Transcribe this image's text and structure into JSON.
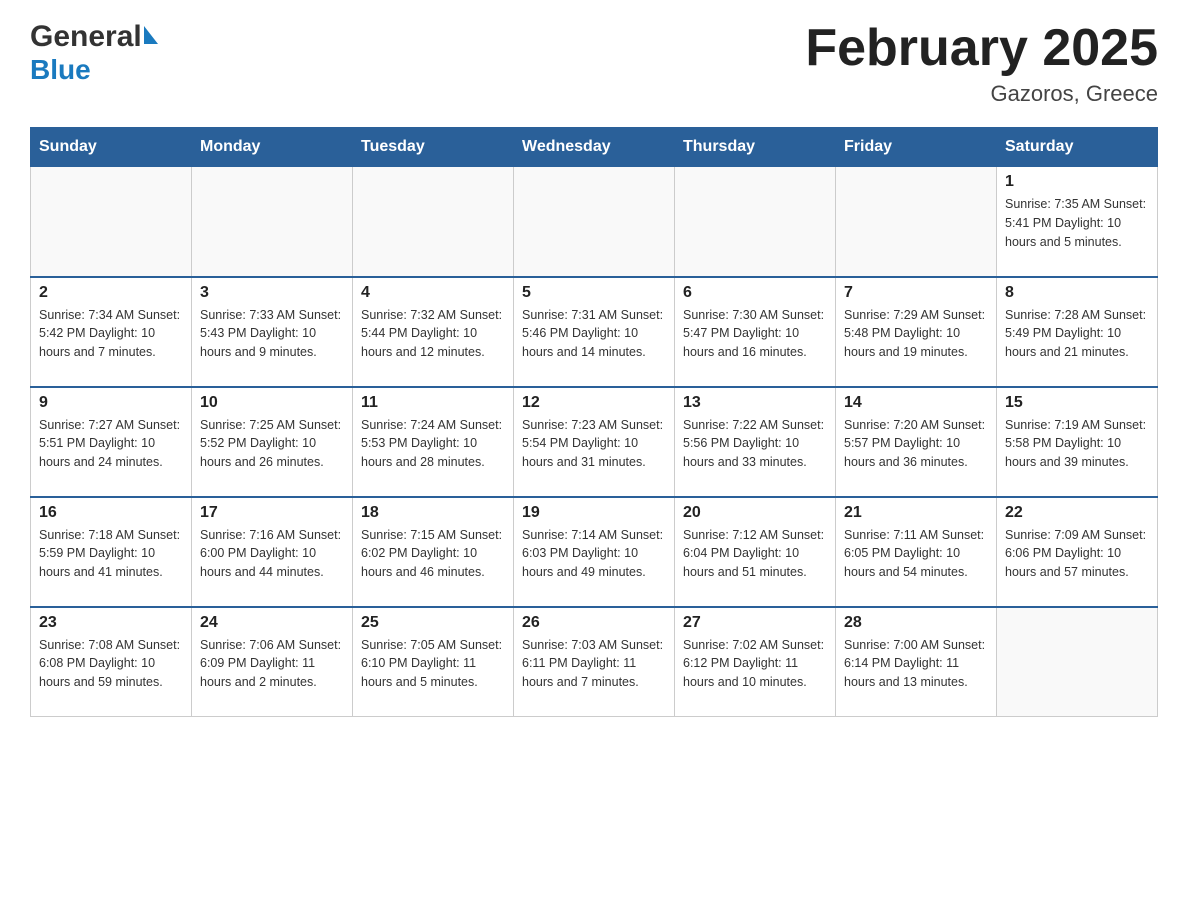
{
  "header": {
    "logo_general": "General",
    "logo_blue": "Blue",
    "month_title": "February 2025",
    "location": "Gazoros, Greece"
  },
  "days_of_week": [
    "Sunday",
    "Monday",
    "Tuesday",
    "Wednesday",
    "Thursday",
    "Friday",
    "Saturday"
  ],
  "weeks": [
    {
      "days": [
        {
          "number": "",
          "info": ""
        },
        {
          "number": "",
          "info": ""
        },
        {
          "number": "",
          "info": ""
        },
        {
          "number": "",
          "info": ""
        },
        {
          "number": "",
          "info": ""
        },
        {
          "number": "",
          "info": ""
        },
        {
          "number": "1",
          "info": "Sunrise: 7:35 AM\nSunset: 5:41 PM\nDaylight: 10 hours and 5 minutes."
        }
      ]
    },
    {
      "days": [
        {
          "number": "2",
          "info": "Sunrise: 7:34 AM\nSunset: 5:42 PM\nDaylight: 10 hours and 7 minutes."
        },
        {
          "number": "3",
          "info": "Sunrise: 7:33 AM\nSunset: 5:43 PM\nDaylight: 10 hours and 9 minutes."
        },
        {
          "number": "4",
          "info": "Sunrise: 7:32 AM\nSunset: 5:44 PM\nDaylight: 10 hours and 12 minutes."
        },
        {
          "number": "5",
          "info": "Sunrise: 7:31 AM\nSunset: 5:46 PM\nDaylight: 10 hours and 14 minutes."
        },
        {
          "number": "6",
          "info": "Sunrise: 7:30 AM\nSunset: 5:47 PM\nDaylight: 10 hours and 16 minutes."
        },
        {
          "number": "7",
          "info": "Sunrise: 7:29 AM\nSunset: 5:48 PM\nDaylight: 10 hours and 19 minutes."
        },
        {
          "number": "8",
          "info": "Sunrise: 7:28 AM\nSunset: 5:49 PM\nDaylight: 10 hours and 21 minutes."
        }
      ]
    },
    {
      "days": [
        {
          "number": "9",
          "info": "Sunrise: 7:27 AM\nSunset: 5:51 PM\nDaylight: 10 hours and 24 minutes."
        },
        {
          "number": "10",
          "info": "Sunrise: 7:25 AM\nSunset: 5:52 PM\nDaylight: 10 hours and 26 minutes."
        },
        {
          "number": "11",
          "info": "Sunrise: 7:24 AM\nSunset: 5:53 PM\nDaylight: 10 hours and 28 minutes."
        },
        {
          "number": "12",
          "info": "Sunrise: 7:23 AM\nSunset: 5:54 PM\nDaylight: 10 hours and 31 minutes."
        },
        {
          "number": "13",
          "info": "Sunrise: 7:22 AM\nSunset: 5:56 PM\nDaylight: 10 hours and 33 minutes."
        },
        {
          "number": "14",
          "info": "Sunrise: 7:20 AM\nSunset: 5:57 PM\nDaylight: 10 hours and 36 minutes."
        },
        {
          "number": "15",
          "info": "Sunrise: 7:19 AM\nSunset: 5:58 PM\nDaylight: 10 hours and 39 minutes."
        }
      ]
    },
    {
      "days": [
        {
          "number": "16",
          "info": "Sunrise: 7:18 AM\nSunset: 5:59 PM\nDaylight: 10 hours and 41 minutes."
        },
        {
          "number": "17",
          "info": "Sunrise: 7:16 AM\nSunset: 6:00 PM\nDaylight: 10 hours and 44 minutes."
        },
        {
          "number": "18",
          "info": "Sunrise: 7:15 AM\nSunset: 6:02 PM\nDaylight: 10 hours and 46 minutes."
        },
        {
          "number": "19",
          "info": "Sunrise: 7:14 AM\nSunset: 6:03 PM\nDaylight: 10 hours and 49 minutes."
        },
        {
          "number": "20",
          "info": "Sunrise: 7:12 AM\nSunset: 6:04 PM\nDaylight: 10 hours and 51 minutes."
        },
        {
          "number": "21",
          "info": "Sunrise: 7:11 AM\nSunset: 6:05 PM\nDaylight: 10 hours and 54 minutes."
        },
        {
          "number": "22",
          "info": "Sunrise: 7:09 AM\nSunset: 6:06 PM\nDaylight: 10 hours and 57 minutes."
        }
      ]
    },
    {
      "days": [
        {
          "number": "23",
          "info": "Sunrise: 7:08 AM\nSunset: 6:08 PM\nDaylight: 10 hours and 59 minutes."
        },
        {
          "number": "24",
          "info": "Sunrise: 7:06 AM\nSunset: 6:09 PM\nDaylight: 11 hours and 2 minutes."
        },
        {
          "number": "25",
          "info": "Sunrise: 7:05 AM\nSunset: 6:10 PM\nDaylight: 11 hours and 5 minutes."
        },
        {
          "number": "26",
          "info": "Sunrise: 7:03 AM\nSunset: 6:11 PM\nDaylight: 11 hours and 7 minutes."
        },
        {
          "number": "27",
          "info": "Sunrise: 7:02 AM\nSunset: 6:12 PM\nDaylight: 11 hours and 10 minutes."
        },
        {
          "number": "28",
          "info": "Sunrise: 7:00 AM\nSunset: 6:14 PM\nDaylight: 11 hours and 13 minutes."
        },
        {
          "number": "",
          "info": ""
        }
      ]
    }
  ]
}
